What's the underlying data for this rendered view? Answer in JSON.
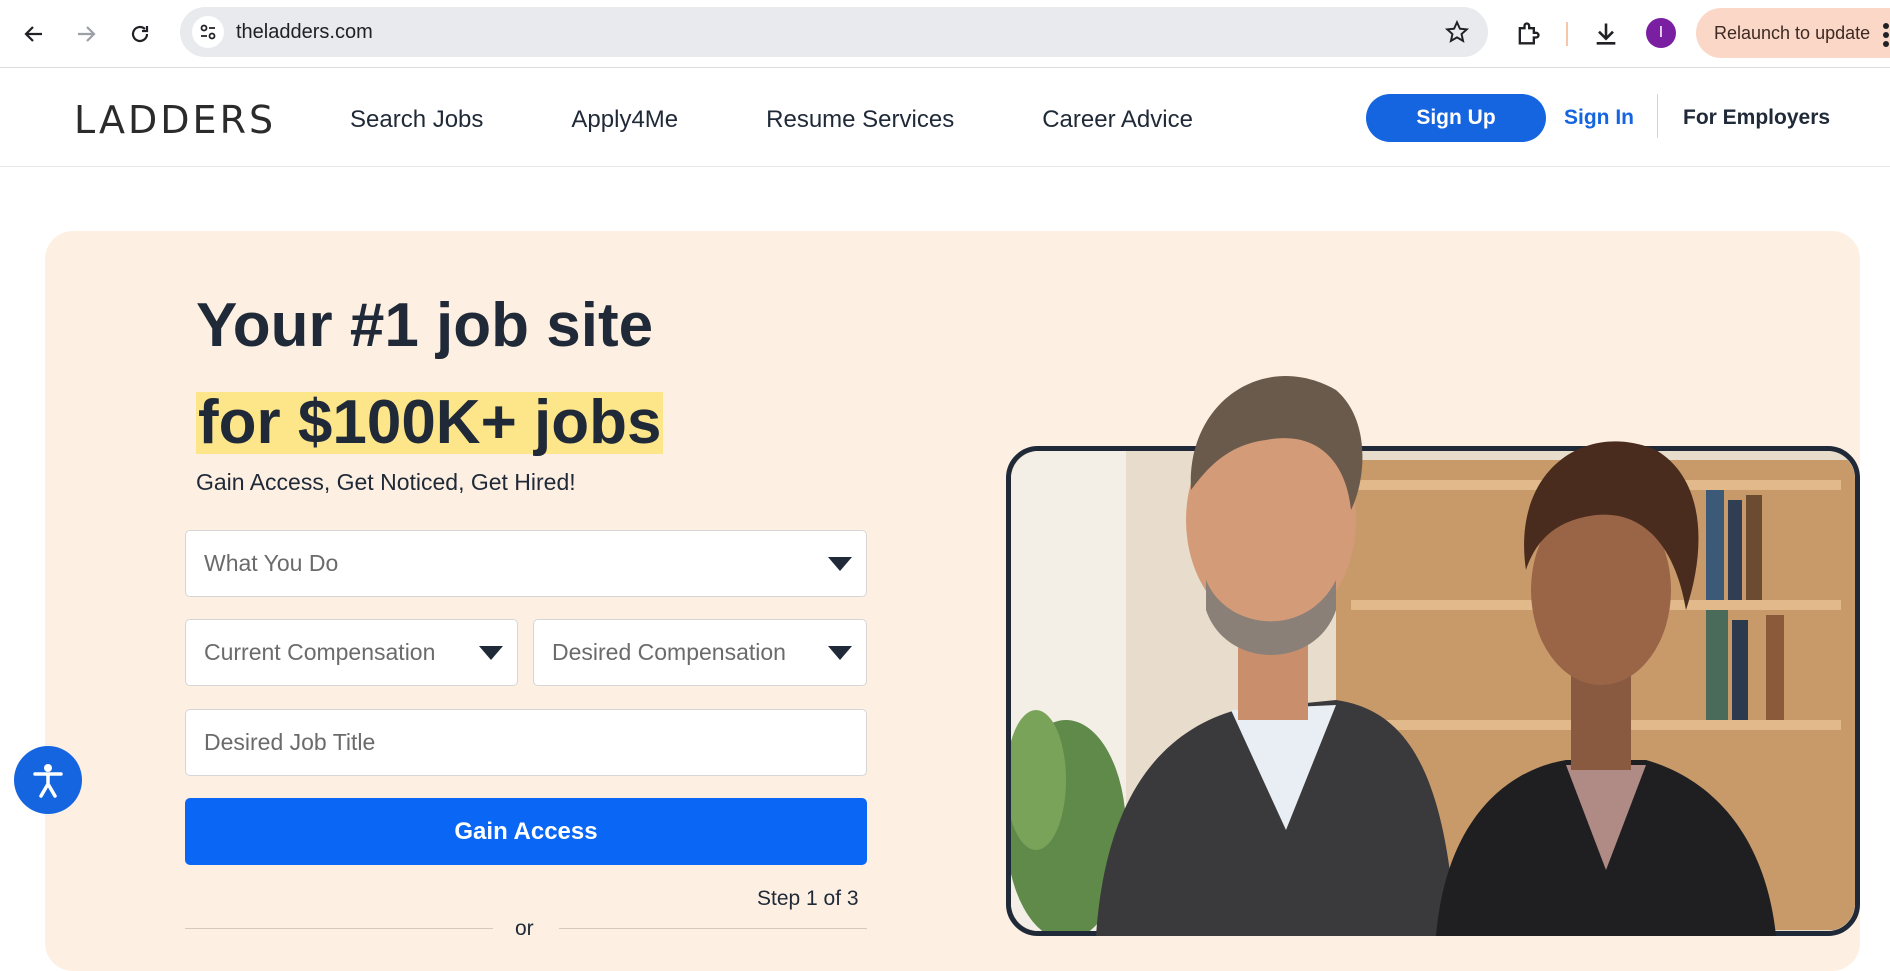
{
  "browser": {
    "url": "theladders.com",
    "relaunch_label": "Relaunch to update",
    "profile_initial": "I",
    "icons": [
      "back-arrow-icon",
      "forward-arrow-icon",
      "reload-icon",
      "site-info-icon",
      "star-icon",
      "extensions-icon",
      "download-icon",
      "more-vert-icon"
    ]
  },
  "header": {
    "logo": "LADDERS",
    "nav": [
      "Search Jobs",
      "Apply4Me",
      "Resume Services",
      "Career Advice"
    ],
    "signup": "Sign Up",
    "signin": "Sign In",
    "employers": "For Employers"
  },
  "hero": {
    "headline_line1": "Your #1 job site",
    "headline_line2": "for $100K+ jobs",
    "tagline": "Gain Access, Get Noticed, Get Hired!",
    "what_you_do": "What You Do",
    "current_comp": "Current Compensation",
    "desired_comp": "Desired Compensation",
    "job_title_placeholder": "Desired Job Title",
    "cta": "Gain Access",
    "step": "Step 1 of 3",
    "or": "or"
  },
  "colors": {
    "brand_blue": "#1565e0",
    "cta_blue": "#0a66f5",
    "hero_bg": "#fdf0e3",
    "highlight": "#fde68a"
  }
}
